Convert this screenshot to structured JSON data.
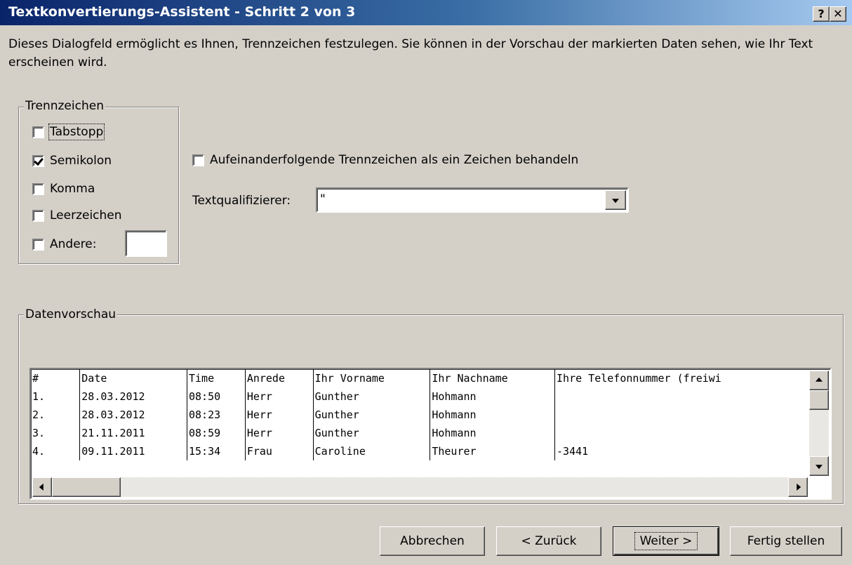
{
  "window": {
    "title": "Textkonvertierungs-Assistent - Schritt 2 von 3",
    "help_glyph": "?",
    "close_glyph": "✕"
  },
  "description": "Dieses Dialogfeld ermöglicht es Ihnen, Trennzeichen festzulegen. Sie können in der Vorschau der markierten Daten sehen, wie Ihr Text erscheinen wird.",
  "delimiters": {
    "group_label": "Trennzeichen",
    "items": [
      {
        "label": "Tabstopp",
        "checked": false
      },
      {
        "label": "Semikolon",
        "checked": true
      },
      {
        "label": "Komma",
        "checked": false
      },
      {
        "label": "Leerzeichen",
        "checked": false
      },
      {
        "label": "Andere:",
        "checked": false
      }
    ],
    "other_value": ""
  },
  "consecutive": {
    "label": "Aufeinanderfolgende Trennzeichen als ein Zeichen behandeln",
    "checked": false
  },
  "text_qualifier": {
    "label": "Textqualifizierer:",
    "value": "\""
  },
  "preview": {
    "group_label": "Datenvorschau",
    "columns": [
      "#",
      "Date",
      "Time",
      "Anrede",
      "Ihr Vorname",
      "Ihr Nachname",
      "Ihre Telefonnummer (freiwi"
    ],
    "rows": [
      [
        "1.",
        "28.03.2012",
        "08:50",
        "Herr",
        "Gunther",
        "Hohmann",
        ""
      ],
      [
        "2.",
        "28.03.2012",
        "08:23",
        "Herr",
        "Gunther",
        "Hohmann",
        ""
      ],
      [
        "3.",
        "21.11.2011",
        "08:59",
        "Herr",
        "Gunther",
        "Hohmann",
        ""
      ],
      [
        "4.",
        "09.11.2011",
        "15:34",
        "Frau",
        "Caroline",
        "Theurer",
        "-3441"
      ]
    ]
  },
  "buttons": {
    "cancel": "Abbrechen",
    "back": "< Zurück",
    "next": "Weiter >",
    "finish": "Fertig stellen"
  },
  "colors": {
    "title_start": "#0a246a",
    "title_end": "#a6caf0",
    "face": "#d4d0c8"
  }
}
